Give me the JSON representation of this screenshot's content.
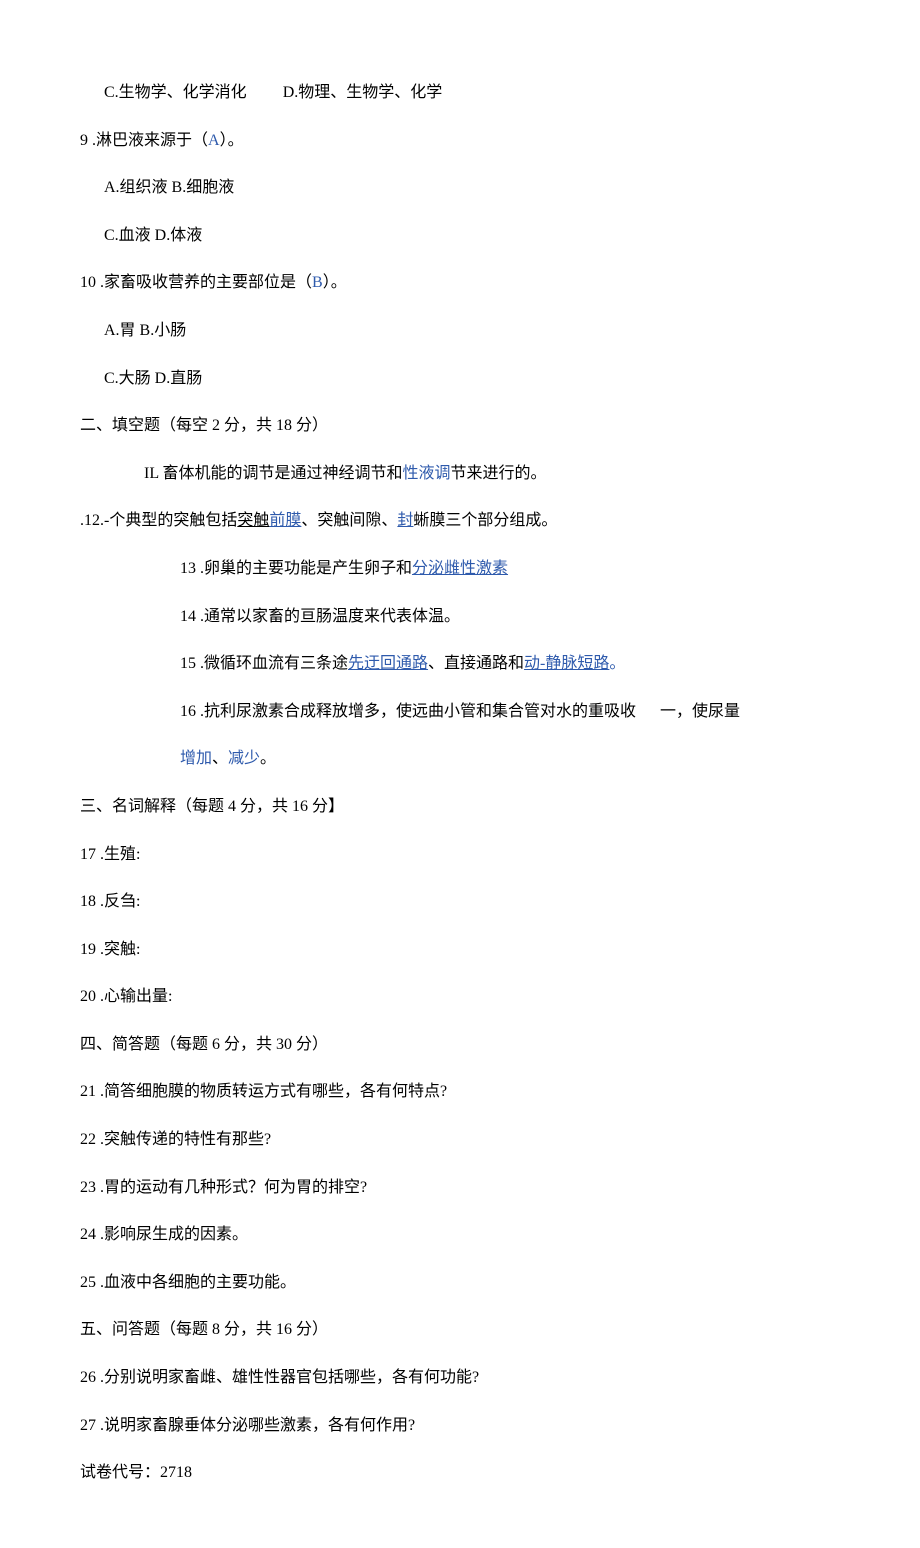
{
  "q8": {
    "optC": "C.生物学、化学消化",
    "optD": "D.物理、生物学、化学"
  },
  "q9": {
    "stem_a": "9 .淋巴液来源于（",
    "ans": "A",
    "stem_b": "）。",
    "optA": "A.组织液 B.细胞液",
    "optC": "C.血液 D.体液"
  },
  "q10": {
    "stem_a": "10 .家畜吸收营养的主要部位是（",
    "ans": "B",
    "stem_b": "）。",
    "optA": "A.胃 B.小肠",
    "optC": "C.大肠 D.直肠"
  },
  "sec2": {
    "title": "二、填空题（每空 2 分，共 18 分）",
    "q11_a": "IL 畜体机能的调节是通过神经调节和",
    "q11_b": "性液调",
    "q11_c": "节来进行的。",
    "q12_a": ".12.-个典型的突触包括",
    "q12_b": "突触",
    "q12_c": "前膜",
    "q12_d": "、突触间隙、",
    "q12_e": "封",
    "q12_f": "蜥膜三个部分组成。",
    "q13_a": "13 .卵巢的主要功能是产生卵子和",
    "q13_b": "分泌雌性激素",
    "q14": "14 .通常以家畜的亘肠温度来代表体温。",
    "q15_a": "15 .微循环血流有三条途",
    "q15_b": "先迂回通路",
    "q15_c": "、直接通路和",
    "q15_d": "动-静脉短路",
    "q15_e": "。",
    "q16_a": "16 .抗利尿激素合成释放增多，使远曲小管和集合管对水的重吸收",
    "q16_b": "一，使尿量",
    "q16_c": "增加",
    "q16_d": "、",
    "q16_e": "减少",
    "q16_f": "。"
  },
  "sec3": {
    "title": "三、名词解释（每题 4 分，共 16 分】",
    "q17": "17 .生殖:",
    "q18": "18 .反刍:",
    "q19": "19 .突触:",
    "q20": "20 .心输出量:"
  },
  "sec4": {
    "title": "四、简答题（每题 6 分，共 30 分）",
    "q21": "21 .简答细胞膜的物质转运方式有哪些，各有何特点?",
    "q22": "22 .突触传递的特性有那些?",
    "q23": "23 .胃的运动有几种形式？何为胃的排空?",
    "q24": "24 .影响尿生成的因素。",
    "q25": "25 .血液中各细胞的主要功能。"
  },
  "sec5": {
    "title": "五、问答题（每题 8 分，共 16 分）",
    "q26": "26 .分别说明家畜雌、雄性性器官包括哪些，各有何功能?",
    "q27": "27 .说明家畜腺垂体分泌哪些激素，各有何作用?"
  },
  "footer": "试卷代号：2718"
}
